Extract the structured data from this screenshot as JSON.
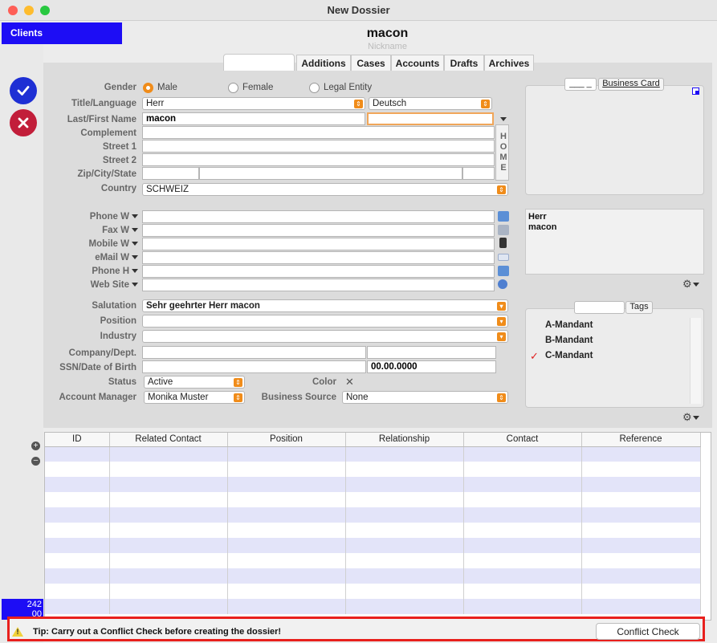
{
  "window": {
    "title": "New Dossier",
    "traffic_colors": [
      "#fe5f57",
      "#febc2e",
      "#28c840"
    ]
  },
  "sidebar": {
    "clients_label": "Clients",
    "counter_line1": "242",
    "counter_line2": "00"
  },
  "header": {
    "name": "macon",
    "nickname_placeholder": "Nickname"
  },
  "tabs": [
    {
      "label": ""
    },
    {
      "label": "Additions"
    },
    {
      "label": "Cases"
    },
    {
      "label": "Accounts"
    },
    {
      "label": "Drafts"
    },
    {
      "label": "Archives"
    }
  ],
  "form": {
    "gender_label": "Gender",
    "gender_options": [
      "Male",
      "Female",
      "Legal Entity"
    ],
    "gender_selected": "Male",
    "title_language_label": "Title/Language",
    "title_value": "Herr",
    "language_value": "Deutsch",
    "name_label": "Last/First Name",
    "last_name": "macon",
    "first_name": "",
    "complement_label": "Complement",
    "street1_label": "Street 1",
    "street2_label": "Street 2",
    "zip_city_state_label": "Zip/City/State",
    "country_label": "Country",
    "country_value": "SCHWEIZ",
    "home_label": "HOME",
    "phone_w_label": "Phone W",
    "fax_w_label": "Fax W",
    "mobile_w_label": "Mobile W",
    "email_w_label": "eMail W",
    "phone_h_label": "Phone H",
    "website_label": "Web Site",
    "salutation_label": "Salutation",
    "salutation_value": "Sehr geehrter Herr macon",
    "position_label": "Position",
    "industry_label": "Industry",
    "company_label": "Company/Dept.",
    "ssn_dob_label": "SSN/Date of Birth",
    "dob_value": "00.00.0000",
    "status_label": "Status",
    "status_value": "Active",
    "color_label": "Color",
    "color_value": "✕",
    "account_manager_label": "Account Manager",
    "account_manager_value": "Monika Muster",
    "business_source_label": "Business Source",
    "business_source_value": "None"
  },
  "business_card": {
    "field_value": "___ _",
    "label": "Business Card"
  },
  "address_preview": {
    "line1": "Herr",
    "line2": "macon"
  },
  "tags": {
    "label": "Tags",
    "items": [
      {
        "name": "A-Mandant",
        "checked": false
      },
      {
        "name": "B-Mandant",
        "checked": false
      },
      {
        "name": "C-Mandant",
        "checked": true
      }
    ],
    "check_mark": "✓"
  },
  "relations_table": {
    "columns": [
      "ID",
      "Related Contact",
      "Position",
      "Relationship",
      "Contact",
      "Reference"
    ]
  },
  "footer": {
    "tip": "Tip: Carry out a Conflict Check before creating the dossier!",
    "warning_symbol": "!",
    "conflict_check_label": "Conflict Check"
  },
  "colors": {
    "accent_blue": "#1d0df5",
    "confirm_blue": "#1e2fd4",
    "cancel_red": "#c21e3a",
    "orange": "#f08c1a",
    "tip_border": "#e8201d",
    "row_alt": "#e3e4f9"
  }
}
